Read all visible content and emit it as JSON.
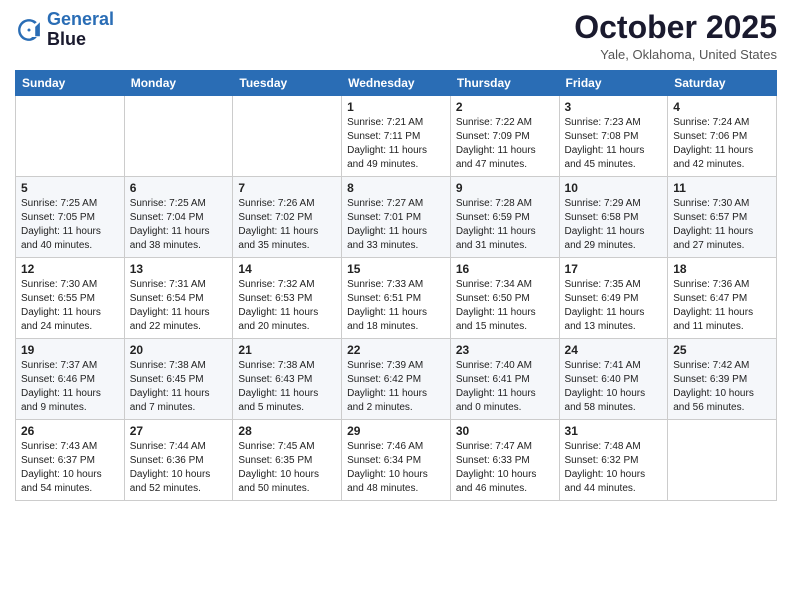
{
  "logo": {
    "line1": "General",
    "line2": "Blue"
  },
  "title": "October 2025",
  "location": "Yale, Oklahoma, United States",
  "days_of_week": [
    "Sunday",
    "Monday",
    "Tuesday",
    "Wednesday",
    "Thursday",
    "Friday",
    "Saturday"
  ],
  "weeks": [
    [
      {
        "day": "",
        "sunrise": "",
        "sunset": "",
        "daylight": ""
      },
      {
        "day": "",
        "sunrise": "",
        "sunset": "",
        "daylight": ""
      },
      {
        "day": "",
        "sunrise": "",
        "sunset": "",
        "daylight": ""
      },
      {
        "day": "1",
        "sunrise": "Sunrise: 7:21 AM",
        "sunset": "Sunset: 7:11 PM",
        "daylight": "Daylight: 11 hours and 49 minutes."
      },
      {
        "day": "2",
        "sunrise": "Sunrise: 7:22 AM",
        "sunset": "Sunset: 7:09 PM",
        "daylight": "Daylight: 11 hours and 47 minutes."
      },
      {
        "day": "3",
        "sunrise": "Sunrise: 7:23 AM",
        "sunset": "Sunset: 7:08 PM",
        "daylight": "Daylight: 11 hours and 45 minutes."
      },
      {
        "day": "4",
        "sunrise": "Sunrise: 7:24 AM",
        "sunset": "Sunset: 7:06 PM",
        "daylight": "Daylight: 11 hours and 42 minutes."
      }
    ],
    [
      {
        "day": "5",
        "sunrise": "Sunrise: 7:25 AM",
        "sunset": "Sunset: 7:05 PM",
        "daylight": "Daylight: 11 hours and 40 minutes."
      },
      {
        "day": "6",
        "sunrise": "Sunrise: 7:25 AM",
        "sunset": "Sunset: 7:04 PM",
        "daylight": "Daylight: 11 hours and 38 minutes."
      },
      {
        "day": "7",
        "sunrise": "Sunrise: 7:26 AM",
        "sunset": "Sunset: 7:02 PM",
        "daylight": "Daylight: 11 hours and 35 minutes."
      },
      {
        "day": "8",
        "sunrise": "Sunrise: 7:27 AM",
        "sunset": "Sunset: 7:01 PM",
        "daylight": "Daylight: 11 hours and 33 minutes."
      },
      {
        "day": "9",
        "sunrise": "Sunrise: 7:28 AM",
        "sunset": "Sunset: 6:59 PM",
        "daylight": "Daylight: 11 hours and 31 minutes."
      },
      {
        "day": "10",
        "sunrise": "Sunrise: 7:29 AM",
        "sunset": "Sunset: 6:58 PM",
        "daylight": "Daylight: 11 hours and 29 minutes."
      },
      {
        "day": "11",
        "sunrise": "Sunrise: 7:30 AM",
        "sunset": "Sunset: 6:57 PM",
        "daylight": "Daylight: 11 hours and 27 minutes."
      }
    ],
    [
      {
        "day": "12",
        "sunrise": "Sunrise: 7:30 AM",
        "sunset": "Sunset: 6:55 PM",
        "daylight": "Daylight: 11 hours and 24 minutes."
      },
      {
        "day": "13",
        "sunrise": "Sunrise: 7:31 AM",
        "sunset": "Sunset: 6:54 PM",
        "daylight": "Daylight: 11 hours and 22 minutes."
      },
      {
        "day": "14",
        "sunrise": "Sunrise: 7:32 AM",
        "sunset": "Sunset: 6:53 PM",
        "daylight": "Daylight: 11 hours and 20 minutes."
      },
      {
        "day": "15",
        "sunrise": "Sunrise: 7:33 AM",
        "sunset": "Sunset: 6:51 PM",
        "daylight": "Daylight: 11 hours and 18 minutes."
      },
      {
        "day": "16",
        "sunrise": "Sunrise: 7:34 AM",
        "sunset": "Sunset: 6:50 PM",
        "daylight": "Daylight: 11 hours and 15 minutes."
      },
      {
        "day": "17",
        "sunrise": "Sunrise: 7:35 AM",
        "sunset": "Sunset: 6:49 PM",
        "daylight": "Daylight: 11 hours and 13 minutes."
      },
      {
        "day": "18",
        "sunrise": "Sunrise: 7:36 AM",
        "sunset": "Sunset: 6:47 PM",
        "daylight": "Daylight: 11 hours and 11 minutes."
      }
    ],
    [
      {
        "day": "19",
        "sunrise": "Sunrise: 7:37 AM",
        "sunset": "Sunset: 6:46 PM",
        "daylight": "Daylight: 11 hours and 9 minutes."
      },
      {
        "day": "20",
        "sunrise": "Sunrise: 7:38 AM",
        "sunset": "Sunset: 6:45 PM",
        "daylight": "Daylight: 11 hours and 7 minutes."
      },
      {
        "day": "21",
        "sunrise": "Sunrise: 7:38 AM",
        "sunset": "Sunset: 6:43 PM",
        "daylight": "Daylight: 11 hours and 5 minutes."
      },
      {
        "day": "22",
        "sunrise": "Sunrise: 7:39 AM",
        "sunset": "Sunset: 6:42 PM",
        "daylight": "Daylight: 11 hours and 2 minutes."
      },
      {
        "day": "23",
        "sunrise": "Sunrise: 7:40 AM",
        "sunset": "Sunset: 6:41 PM",
        "daylight": "Daylight: 11 hours and 0 minutes."
      },
      {
        "day": "24",
        "sunrise": "Sunrise: 7:41 AM",
        "sunset": "Sunset: 6:40 PM",
        "daylight": "Daylight: 10 hours and 58 minutes."
      },
      {
        "day": "25",
        "sunrise": "Sunrise: 7:42 AM",
        "sunset": "Sunset: 6:39 PM",
        "daylight": "Daylight: 10 hours and 56 minutes."
      }
    ],
    [
      {
        "day": "26",
        "sunrise": "Sunrise: 7:43 AM",
        "sunset": "Sunset: 6:37 PM",
        "daylight": "Daylight: 10 hours and 54 minutes."
      },
      {
        "day": "27",
        "sunrise": "Sunrise: 7:44 AM",
        "sunset": "Sunset: 6:36 PM",
        "daylight": "Daylight: 10 hours and 52 minutes."
      },
      {
        "day": "28",
        "sunrise": "Sunrise: 7:45 AM",
        "sunset": "Sunset: 6:35 PM",
        "daylight": "Daylight: 10 hours and 50 minutes."
      },
      {
        "day": "29",
        "sunrise": "Sunrise: 7:46 AM",
        "sunset": "Sunset: 6:34 PM",
        "daylight": "Daylight: 10 hours and 48 minutes."
      },
      {
        "day": "30",
        "sunrise": "Sunrise: 7:47 AM",
        "sunset": "Sunset: 6:33 PM",
        "daylight": "Daylight: 10 hours and 46 minutes."
      },
      {
        "day": "31",
        "sunrise": "Sunrise: 7:48 AM",
        "sunset": "Sunset: 6:32 PM",
        "daylight": "Daylight: 10 hours and 44 minutes."
      },
      {
        "day": "",
        "sunrise": "",
        "sunset": "",
        "daylight": ""
      }
    ]
  ]
}
